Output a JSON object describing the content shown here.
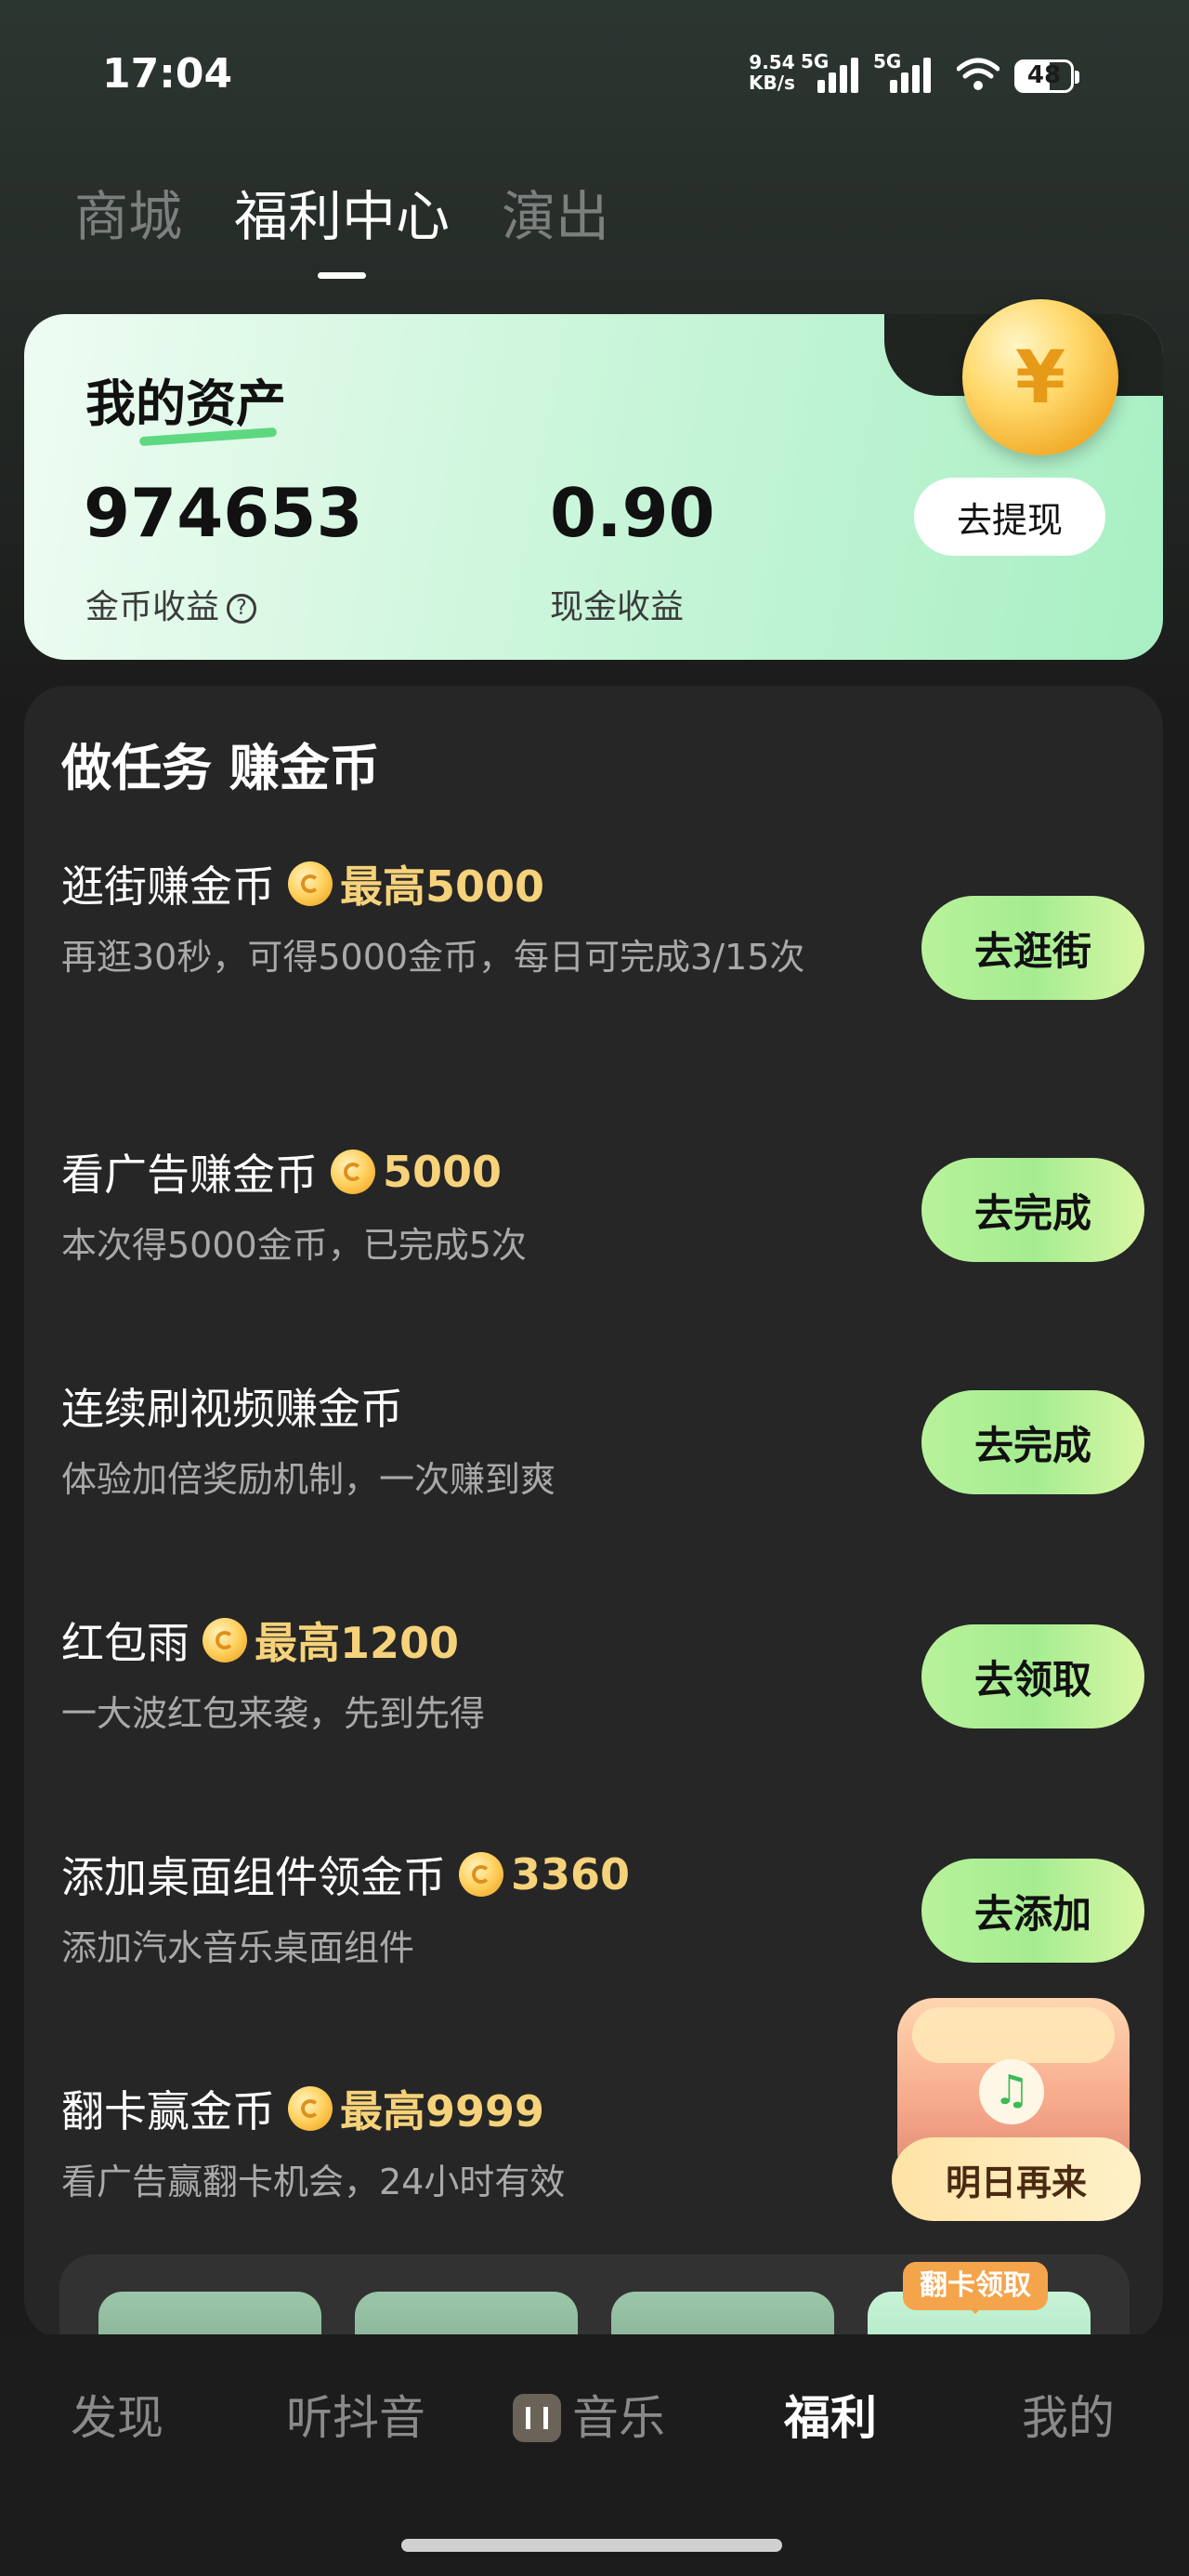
{
  "status_bar": {
    "time": "17:04",
    "rate_value": "9.54",
    "rate_unit": "KB/s",
    "net1": "5G",
    "net2": "5G",
    "battery": "48"
  },
  "top_tabs": [
    "商城",
    "福利中心",
    "演出"
  ],
  "assets": {
    "title": "我的资产",
    "coins_value": "974653",
    "coins_label": "金币收益",
    "cash_value": "0.90",
    "cash_label": "现金收益",
    "withdraw_label": "去提现"
  },
  "tasks": {
    "heading": "做任务 赚金币",
    "items": [
      {
        "title": "逛街赚金币",
        "reward": "最高5000",
        "desc": "再逛30秒，可得5000金币，每日可完成3/15次",
        "button": "去逛街"
      },
      {
        "title": "看广告赚金币",
        "reward": "5000",
        "desc": "本次得5000金币，已完成5次",
        "button": "去完成"
      },
      {
        "title": "连续刷视频赚金币",
        "reward": "",
        "desc": "体验加倍奖励机制，一次赚到爽",
        "button": "去完成"
      },
      {
        "title": "红包雨",
        "reward": "最高1200",
        "desc": "一大波红包来袭，先到先得",
        "button": "去领取"
      },
      {
        "title": "添加桌面组件领金币",
        "reward": "3360",
        "desc": "添加汽水音乐桌面组件",
        "button": "去添加"
      },
      {
        "title": "翻卡赢金币",
        "reward": "最高9999",
        "desc": "看广告赢翻卡机会，24小时有效",
        "button": ""
      }
    ]
  },
  "chest": {
    "label": "明日再来"
  },
  "flip_tag": "翻卡领取",
  "bottom_nav": [
    "发现",
    "听抖音",
    "音乐",
    "福利",
    "我的"
  ],
  "colors": {
    "accent_green": "#b8f29a",
    "reward_gold": "#f6d27a"
  }
}
